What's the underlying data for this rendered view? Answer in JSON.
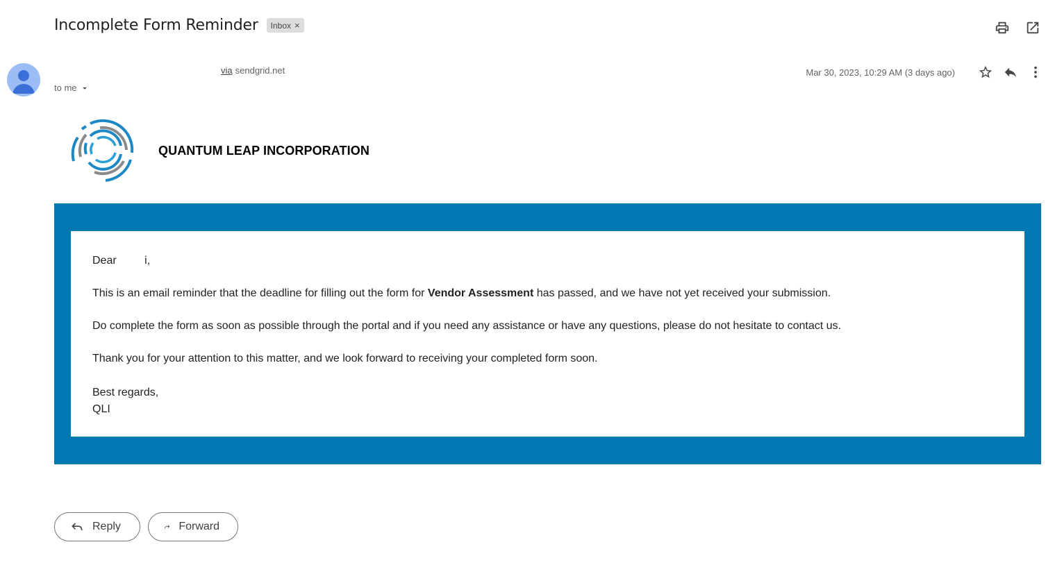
{
  "subject": "Incomplete Form Reminder",
  "label": {
    "text": "Inbox",
    "remove": "×"
  },
  "top_actions": {
    "print": "print-icon",
    "popout": "open-in-new-window-icon"
  },
  "sender": {
    "via_label": "via",
    "via_domain": "sendgrid.net",
    "to_text": "to me"
  },
  "date": "Mar 30, 2023, 10:29 AM (3 days ago)",
  "brand": {
    "name": "QUANTUM LEAP INCORPORATION",
    "accent": "#0078b2"
  },
  "body": {
    "greeting": "Dear",
    "greeting_tail": "i,",
    "p1_before": "This is an email reminder that the deadline for filling out the form for ",
    "p1_bold": "Vendor Assessment",
    "p1_after": " has passed, and we have not yet received your submission.",
    "p2": "Do complete the form as soon as possible through the portal and if you need any assistance or have any questions, please do not hesitate to contact us.",
    "p3": "Thank you for your attention to this matter, and we look forward to receiving your completed form soon.",
    "closing": "Best regards,",
    "signature": "QLI"
  },
  "actions": {
    "reply": "Reply",
    "forward": "Forward"
  }
}
